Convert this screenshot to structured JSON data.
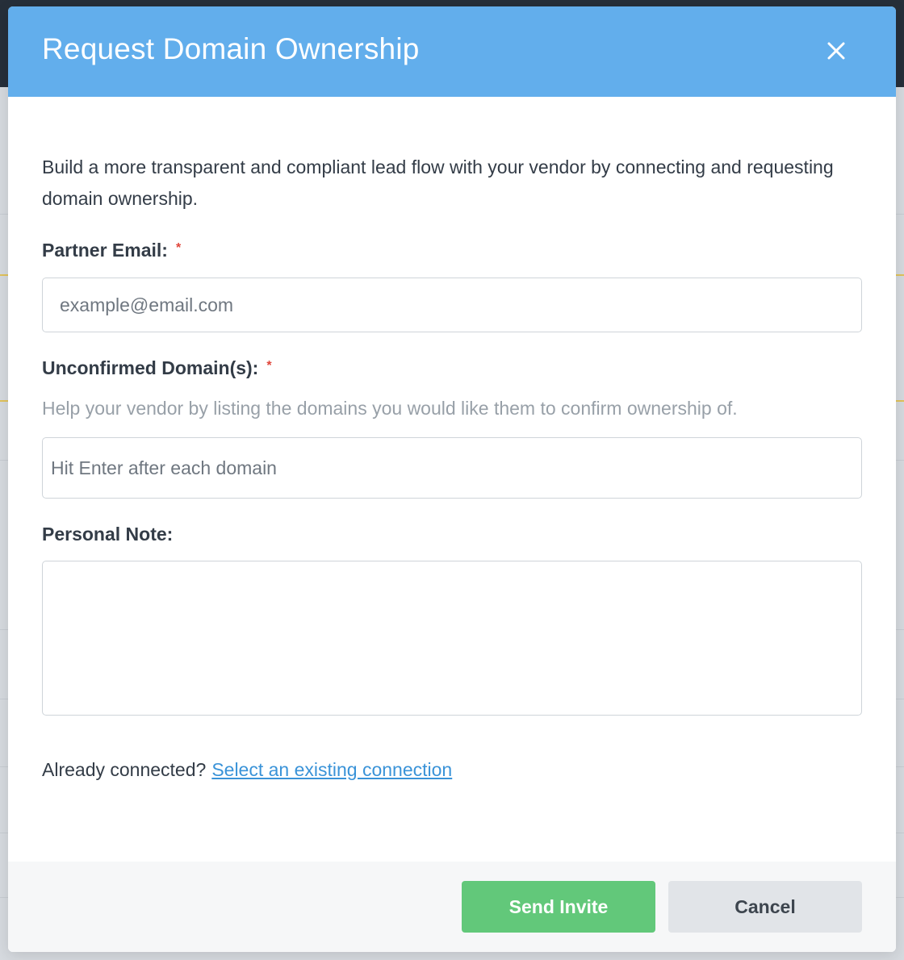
{
  "modal": {
    "title": "Request Domain Ownership",
    "close_icon": "close-icon",
    "intro": "Build a more transparent and compliant lead flow with your vendor by connecting and requesting domain ownership.",
    "partner_email": {
      "label": "Partner Email:",
      "required_marker": "*",
      "value": "",
      "placeholder": "example@email.com"
    },
    "unconfirmed_domains": {
      "label": "Unconfirmed Domain(s):",
      "required_marker": "*",
      "help": "Help your vendor by listing the domains you would like them to confirm ownership of.",
      "value": "",
      "placeholder": "Hit Enter after each domain"
    },
    "personal_note": {
      "label": "Personal Note:",
      "value": ""
    },
    "already_connected_text": "Already connected?",
    "existing_connection_link": "Select an existing connection",
    "footer": {
      "send_label": "Send Invite",
      "cancel_label": "Cancel"
    }
  },
  "colors": {
    "header": "#62aeec",
    "send_button": "#62c87a",
    "cancel_button": "#e1e4e8",
    "link": "#3a93d8",
    "required": "#e0453a"
  }
}
